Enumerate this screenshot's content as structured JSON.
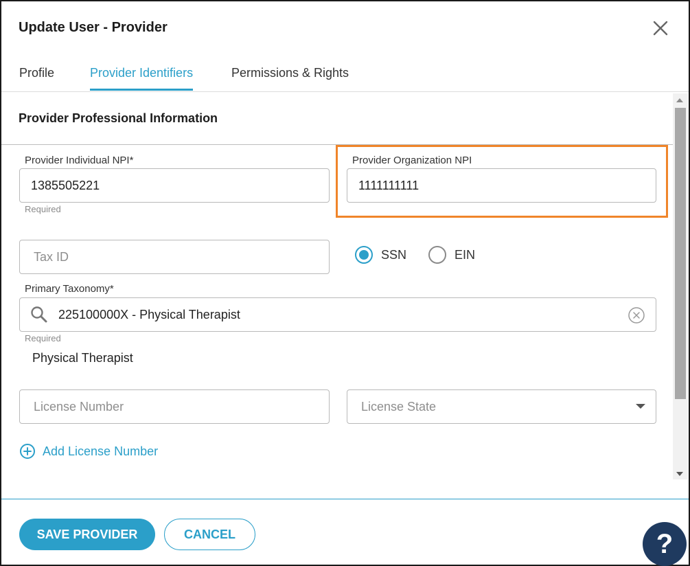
{
  "dialog": {
    "title": "Update User - Provider"
  },
  "tabs": [
    {
      "label": "Profile"
    },
    {
      "label": "Provider Identifiers"
    },
    {
      "label": "Permissions & Rights"
    }
  ],
  "section": {
    "title": "Provider Professional Information"
  },
  "fields": {
    "individual_npi": {
      "label": "Provider Individual NPI*",
      "value": "1385505221",
      "hint": "Required"
    },
    "organization_npi": {
      "label": "Provider Organization NPI",
      "value": "1111111111"
    },
    "tax_id": {
      "placeholder": "Tax ID"
    },
    "tax_type": {
      "options": [
        "SSN",
        "EIN"
      ],
      "selected": "SSN"
    },
    "primary_taxonomy": {
      "label": "Primary Taxonomy*",
      "value": "225100000X - Physical Therapist",
      "hint": "Required",
      "description": "Physical Therapist"
    },
    "license_number": {
      "placeholder": "License Number"
    },
    "license_state": {
      "placeholder": "License State"
    }
  },
  "add_license": {
    "label": "Add License Number"
  },
  "footer": {
    "save_label": "SAVE PROVIDER",
    "cancel_label": "CANCEL",
    "help_label": "?"
  },
  "colors": {
    "accent": "#2b9fc9",
    "highlight": "#f0852a",
    "help_bg": "#1f3a5f"
  },
  "icons": {
    "close": "close-icon",
    "search": "search-icon",
    "clear": "clear-circle-icon",
    "add": "plus-circle-icon",
    "dropdown": "chevron-down-icon"
  }
}
